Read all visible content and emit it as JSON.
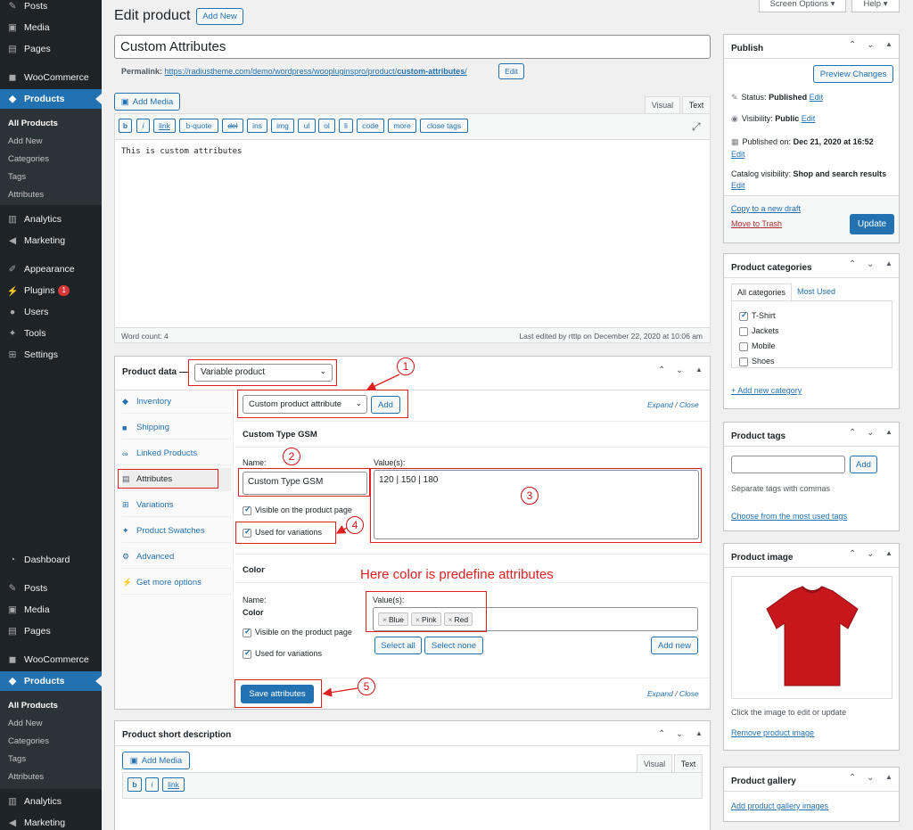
{
  "sidebar": {
    "top_items": [
      {
        "label": "Posts",
        "icon": "pin-icon"
      },
      {
        "label": "Media",
        "icon": "media-icon"
      },
      {
        "label": "Pages",
        "icon": "page-icon"
      },
      {
        "label": "WooCommerce",
        "icon": "woo-icon"
      },
      {
        "label": "Products",
        "icon": "box-icon"
      }
    ],
    "products_sub": [
      "All Products",
      "Add New",
      "Categories",
      "Tags",
      "Attributes"
    ],
    "mid_items": [
      {
        "label": "Analytics",
        "icon": "bar-icon"
      },
      {
        "label": "Marketing",
        "icon": "megaphone-icon"
      },
      {
        "label": "Appearance",
        "icon": "brush-icon"
      },
      {
        "label": "Plugins",
        "icon": "plug-icon",
        "badge": "1"
      },
      {
        "label": "Users",
        "icon": "user-icon"
      },
      {
        "label": "Tools",
        "icon": "wrench-icon"
      },
      {
        "label": "Settings",
        "icon": "settings-icon"
      }
    ],
    "bottom_items": [
      {
        "label": "Dashboard",
        "icon": "gauge-icon"
      },
      {
        "label": "Posts",
        "icon": "pin-icon"
      },
      {
        "label": "Media",
        "icon": "media-icon"
      },
      {
        "label": "Pages",
        "icon": "page-icon"
      },
      {
        "label": "WooCommerce",
        "icon": "woo-icon"
      },
      {
        "label": "Products",
        "icon": "box-icon"
      }
    ],
    "products_sub2": [
      "All Products",
      "Add New",
      "Categories",
      "Tags",
      "Attributes"
    ],
    "end_items": [
      {
        "label": "Analytics",
        "icon": "bar-icon"
      },
      {
        "label": "Marketing",
        "icon": "megaphone-icon"
      }
    ]
  },
  "header": {
    "title": "Edit product",
    "add_new": "Add New",
    "screen_options": "Screen Options ▾",
    "help": "Help ▾"
  },
  "product": {
    "name": "Custom Attributes",
    "permalink_label": "Permalink:",
    "permalink_base": "https://radiustheme.com/demo/wordpress/woopluginspro/product/",
    "permalink_slug": "custom-attributes",
    "permalink_end": "/",
    "edit": "Edit"
  },
  "editor": {
    "add_media": "Add Media",
    "tab_visual": "Visual",
    "tab_text": "Text",
    "quicktags": [
      "b",
      "i",
      "link",
      "b-quote",
      "del",
      "ins",
      "img",
      "ul",
      "ol",
      "li",
      "code",
      "more",
      "close tags"
    ],
    "content": "This is custom attributes",
    "word_count": "Word count: 4",
    "last_edited": "Last edited by rttlp on December 22, 2020 at 10:06 am"
  },
  "product_data": {
    "label": "Product data —",
    "type": "Variable product",
    "tabs": [
      "Inventory",
      "Shipping",
      "Linked Products",
      "Attributes",
      "Variations",
      "Product Swatches",
      "Advanced",
      "Get more options"
    ],
    "attr_select": "Custom product attribute",
    "add": "Add",
    "expand": "Expand",
    "sep": "/",
    "close": "Close",
    "attr1": {
      "heading": "Custom Type GSM",
      "name_label": "Name:",
      "name_value": "Custom Type GSM",
      "values_label": "Value(s):",
      "values": "120 | 150 | 180",
      "visible": "Visible on the product page",
      "variations": "Used for variations"
    },
    "attr2": {
      "heading": "Color",
      "name_label": "Name:",
      "name_value": "Color",
      "values_label": "Value(s):",
      "tags": [
        "Blue",
        "Pink",
        "Red"
      ],
      "visible": "Visible on the product page",
      "variations": "Used for variations",
      "select_all": "Select all",
      "select_none": "Select none",
      "add_new": "Add new"
    },
    "save": "Save attributes"
  },
  "annotations": {
    "n1": "1",
    "n2": "2",
    "n3": "3",
    "n4": "4",
    "n5": "5",
    "note": "Here color is predefine attributes"
  },
  "short_desc": {
    "title": "Product short description",
    "add_media": "Add Media",
    "tab_visual": "Visual",
    "tab_text": "Text",
    "quicktags": [
      "b",
      "i",
      "link"
    ]
  },
  "publish": {
    "title": "Publish",
    "preview": "Preview Changes",
    "status_label": "Status:",
    "status": "Published",
    "visibility_label": "Visibility:",
    "visibility": "Public",
    "published_label": "Published on:",
    "published": "Dec 21, 2020 at 16:52",
    "catalog_label": "Catalog visibility:",
    "catalog": "Shop and search results",
    "edit": "Edit",
    "copy": "Copy to a new draft",
    "trash": "Move to Trash",
    "update": "Update"
  },
  "categories": {
    "title": "Product categories",
    "tab_all": "All categories",
    "tab_used": "Most Used",
    "items": [
      {
        "label": "T-Shirt",
        "checked": true
      },
      {
        "label": "Jackets",
        "checked": false
      },
      {
        "label": "Mobile",
        "checked": false
      },
      {
        "label": "Shoes",
        "checked": false
      }
    ],
    "add": "+ Add new category"
  },
  "tags": {
    "title": "Product tags",
    "add": "Add",
    "hint": "Separate tags with commas",
    "choose": "Choose from the most used tags"
  },
  "image": {
    "title": "Product image",
    "hint": "Click the image to edit or update",
    "remove": "Remove product image",
    "shirt_color": "#c8161d"
  },
  "gallery": {
    "title": "Product gallery",
    "add": "Add product gallery images"
  }
}
